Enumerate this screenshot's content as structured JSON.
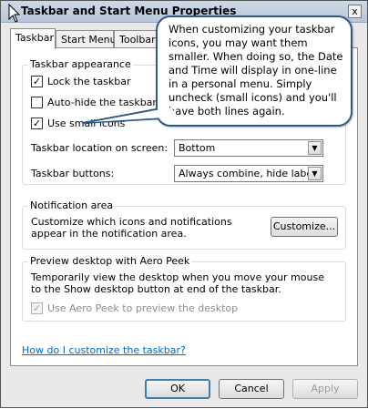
{
  "window": {
    "title": "Taskbar and Start Menu Properties",
    "close_glyph": "x"
  },
  "tabs": [
    {
      "label": "Taskbar",
      "active": true
    },
    {
      "label": "Start Menu",
      "active": false
    },
    {
      "label": "Toolbars",
      "active": false
    }
  ],
  "appearance": {
    "group_label": "Taskbar appearance",
    "lock": {
      "label": "Lock the taskbar",
      "checked": true,
      "mark": "✓"
    },
    "autohide": {
      "label": "Auto-hide the taskbar",
      "checked": false,
      "mark": ""
    },
    "small_icons": {
      "label": "Use small icons",
      "checked": true,
      "mark": "✓"
    },
    "location_label": "Taskbar location on screen:",
    "location_value": "Bottom",
    "buttons_label": "Taskbar buttons:",
    "buttons_value": "Always combine, hide labels",
    "dropdown_glyph": "▼"
  },
  "notification": {
    "group_label": "Notification area",
    "description": "Customize which icons and notifications appear in the notification area.",
    "customize_button": "Customize..."
  },
  "aero_peek": {
    "group_label": "Preview desktop with Aero Peek",
    "description": "Temporarily view the desktop when you move your mouse to the Show desktop button at end of the taskbar.",
    "checkbox_label": "Use Aero Peek to preview the desktop",
    "checked": true,
    "mark": "✓"
  },
  "help_link": "How do I customize the taskbar?",
  "footer": {
    "ok": "OK",
    "cancel": "Cancel",
    "apply": "Apply"
  },
  "callout": {
    "text": "When customizing your taskbar icons, you may want them smaller. When doing so, the Date and Time will display in one-line in a personal menu. Simply uncheck (small icons) and you'll have both lines again."
  }
}
